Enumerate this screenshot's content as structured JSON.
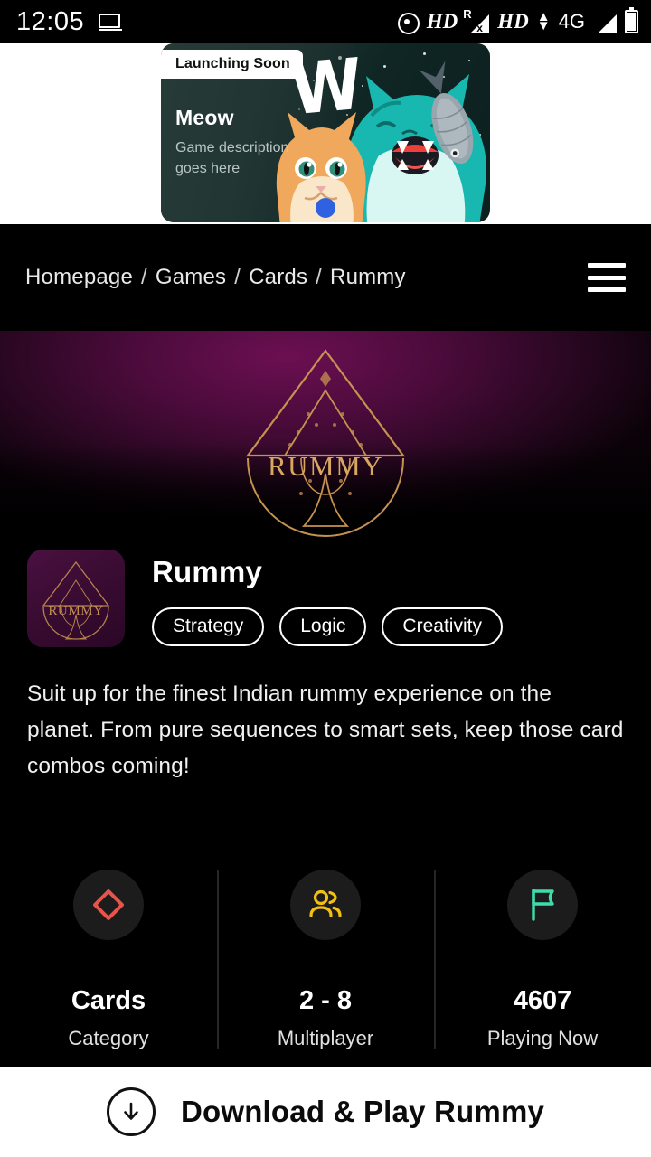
{
  "status_bar": {
    "time": "12:05",
    "laptop_icon": "laptop-icon",
    "cast_icon": "cast-icon",
    "hd_label_1": "HD",
    "roaming_sup": "R",
    "roaming_sub": "x",
    "hd_label_2": "HD",
    "network": "4G",
    "battery_icon": "battery-icon"
  },
  "promo": {
    "badge": "Launching Soon",
    "title": "Meow",
    "description_line1": "Game description",
    "description_line2": "goes here",
    "watermark_letter": "W"
  },
  "breadcrumb": {
    "separator": "/",
    "items": [
      {
        "label": "Homepage"
      },
      {
        "label": "Games"
      },
      {
        "label": "Cards"
      },
      {
        "label": "Rummy"
      }
    ],
    "menu_icon": "hamburger-menu-icon"
  },
  "hero": {
    "logo_text": "Rummy",
    "logo_icon": "spade-logo-icon",
    "gradient_from": "#6c0f52",
    "gradient_to": "#000000"
  },
  "game": {
    "icon_text": "Rummy",
    "title": "Rummy",
    "tags": [
      {
        "label": "Strategy"
      },
      {
        "label": "Logic"
      },
      {
        "label": "Creativity"
      }
    ],
    "description": "Suit up for the finest Indian rummy experience on the planet. From pure sequences to smart sets, keep those card combos coming!"
  },
  "stats": [
    {
      "icon": "diamond-suit-icon",
      "icon_color": "#e8534a",
      "value": "Cards",
      "label": "Category"
    },
    {
      "icon": "users-icon",
      "icon_color": "#f2c015",
      "value": "2 - 8",
      "label": "Multiplayer"
    },
    {
      "icon": "flag-icon",
      "icon_color": "#3ddcab",
      "value": "4607",
      "label": "Playing Now"
    }
  ],
  "cta": {
    "icon": "download-circle-icon",
    "label": "Download & Play Rummy"
  }
}
